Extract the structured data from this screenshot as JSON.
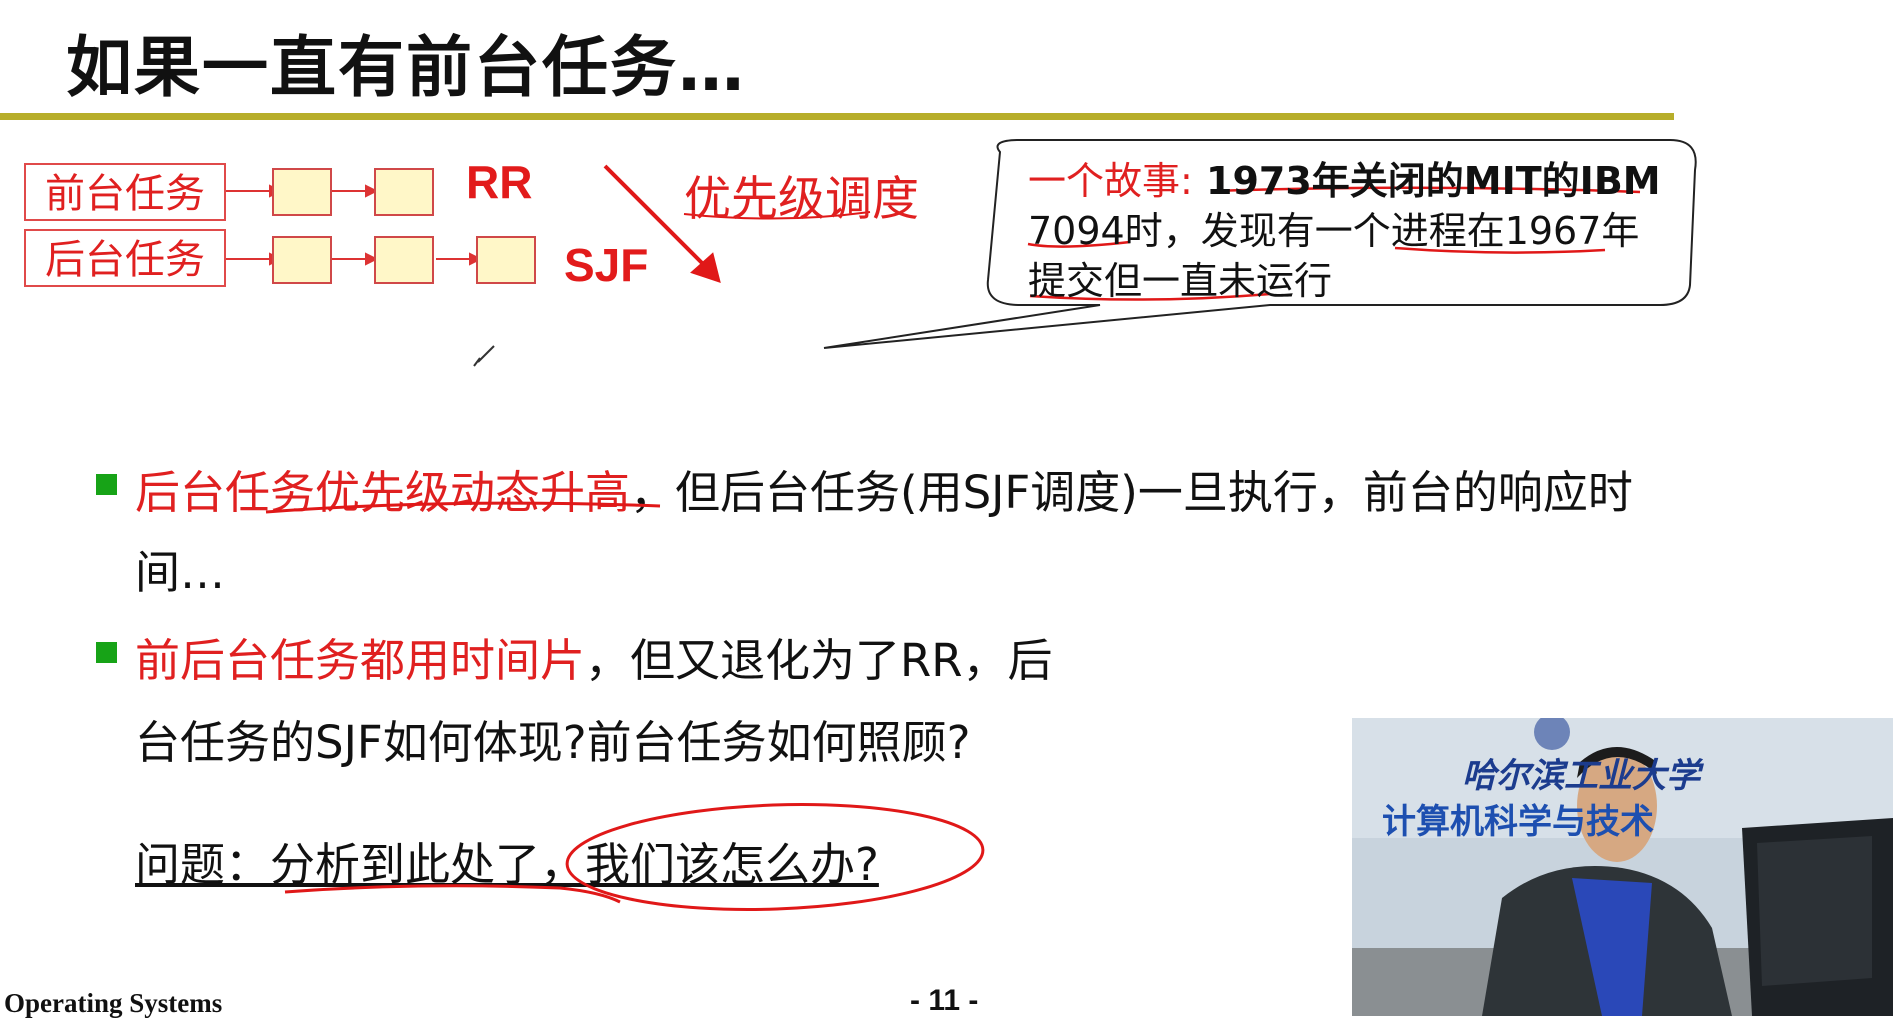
{
  "slide": {
    "title": "如果一直有前台任务…",
    "queues": {
      "foreground_label": "前台任务",
      "background_label": "后台任务",
      "rr_label": "RR",
      "sjf_label": "SJF",
      "priority_label": "优先级调度"
    },
    "callout": {
      "lead": "一个故事:",
      "line1_rest": " 1973年关闭的MIT的IBM",
      "line2": "7094时，发现有一个进程在1967年",
      "line3": "提交但一直未运行"
    },
    "bullets": [
      {
        "red": "后台任务优先级动态升高",
        "rest": "，但后台任务(用SJF调度)一旦执行，前台的响应时",
        "cont": "间…"
      },
      {
        "red": "前后台任务都用时间片",
        "rest": "，但又退化为了RR，后",
        "cont": "台任务的SJF如何体现?前台任务如何照顾?"
      }
    ],
    "question": "问题：分析到此处了，我们该怎么办?",
    "footer": {
      "course": "Operating Systems",
      "page": "- 11 -"
    }
  },
  "video": {
    "line1": "哈尔滨工业大学",
    "line2": "计算机科学与技术"
  },
  "colors": {
    "title_rule": "#b7ae2a",
    "accent_red": "#e02020",
    "bullet_green": "#17a317",
    "queue_box_fill": "#fff7c8"
  }
}
